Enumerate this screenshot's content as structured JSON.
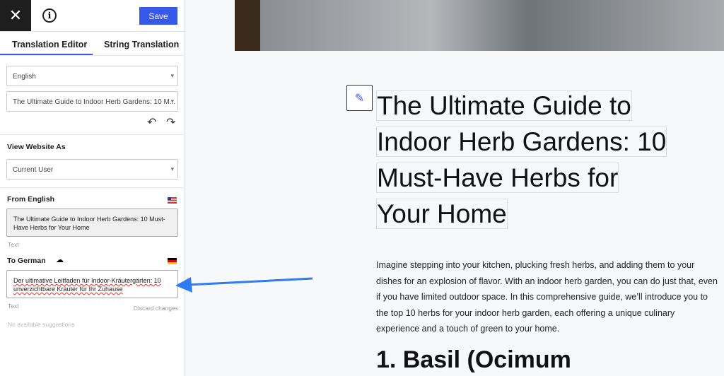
{
  "toolbar": {
    "close_icon": "close-icon",
    "info_icon": "info-icon",
    "save_label": "Save",
    "accent": "#3858e9"
  },
  "tabs": [
    {
      "label": "Translation Editor",
      "active": true
    },
    {
      "label": "String Translation",
      "active": false
    }
  ],
  "language_select": "English",
  "string_select": "The Ultimate Guide to Indoor Herb Gardens: 10 M...",
  "view_as": {
    "label": "View Website As",
    "value": "Current User"
  },
  "from": {
    "label": "From English",
    "text": "The Ultimate Guide to Indoor Herb Gardens: 10 Must-Have Herbs for Your Home",
    "type": "Text"
  },
  "to": {
    "label": "To German",
    "text": "Der ultimative Leitfaden für Indoor-Kräutergärten: 10 unverzichtbare Kräuter für Ihr Zuhause",
    "type": "Text",
    "discard": "Discard changes",
    "suggestions": "No available suggestions"
  },
  "page": {
    "title_lines": [
      "The Ultimate Guide to",
      "Indoor Herb Gardens: 10",
      "Must-Have Herbs for",
      "Your Home"
    ],
    "paragraph": "Imagine stepping into your kitchen, plucking fresh herbs, and adding them to your dishes for an explosion of flavor. With an indoor herb garden, you can do just that, even if you have limited outdoor space. In this comprehensive guide, we’ll introduce you to the top 10 herbs for your indoor herb garden, each offering a unique culinary experience and a touch of green to your home.",
    "heading2": "1. Basil (Ocimum"
  }
}
